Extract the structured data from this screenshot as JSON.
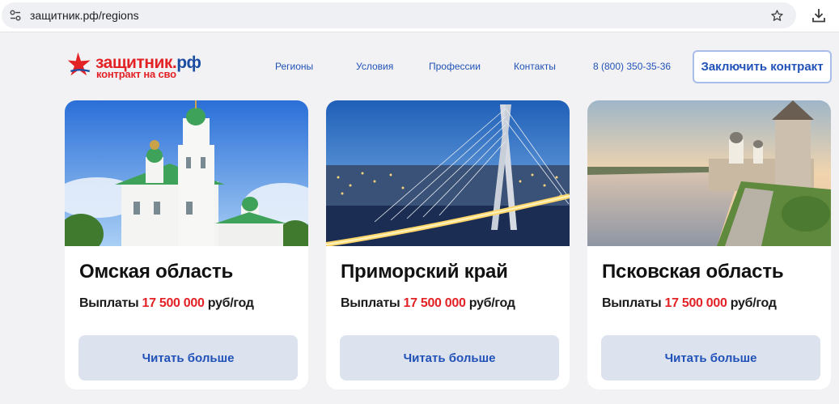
{
  "browser": {
    "url": "защитник.рф/regions",
    "icons": [
      "site-info-icon",
      "bookmark-star-icon",
      "download-icon"
    ]
  },
  "header": {
    "logo": {
      "title_red": "защитник.",
      "title_blue": "рф",
      "subtitle": "контракт на сво"
    },
    "nav": [
      {
        "label": "Регионы"
      },
      {
        "label": "Условия"
      },
      {
        "label": "Профессии"
      },
      {
        "label": "Контакты"
      }
    ],
    "phone": "8 (800) 350-35-36",
    "contract_button": "Заключить контракт"
  },
  "cards": [
    {
      "title": "Омская область",
      "payout_label": "Выплаты",
      "payout_amount": "17 500 000",
      "payout_unit": "руб/год",
      "button": "Читать больше"
    },
    {
      "title": "Приморский край",
      "payout_label": "Выплаты",
      "payout_amount": "17 500 000",
      "payout_unit": "руб/год",
      "button": "Читать больше"
    },
    {
      "title": "Псковская область",
      "payout_label": "Выплаты",
      "payout_amount": "17 500 000",
      "payout_unit": "руб/год",
      "button": "Читать больше"
    }
  ],
  "colors": {
    "accent_blue": "#2152b8",
    "accent_red": "#e32226",
    "button_bg": "#dde2ef",
    "page_bg": "#f2f2f4"
  }
}
